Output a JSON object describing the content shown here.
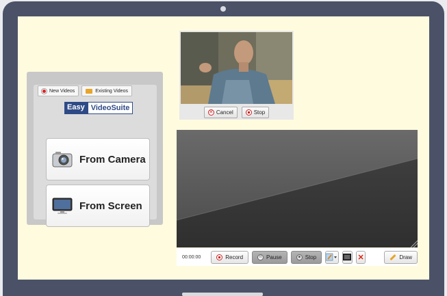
{
  "left_panel": {
    "tabs": [
      {
        "label": "New Videos"
      },
      {
        "label": "Existing Videos"
      }
    ],
    "logo": {
      "easy": "Easy",
      "videosuite": "VideoSuite"
    },
    "buttons": {
      "camera": "From Camera",
      "screen": "From Screen"
    }
  },
  "camera_preview": {
    "cancel_label": "Cancel",
    "stop_label": "Stop"
  },
  "recorder": {
    "time": "00:00:00",
    "record_label": "Record",
    "pause_label": "Pause",
    "stop_label": "Stop",
    "draw_label": "Draw"
  },
  "colors": {
    "screen_bg": "#fffbdf",
    "laptop_frame": "#4b5267",
    "record_red": "#cc2222",
    "logo_blue": "#2e4a86"
  }
}
